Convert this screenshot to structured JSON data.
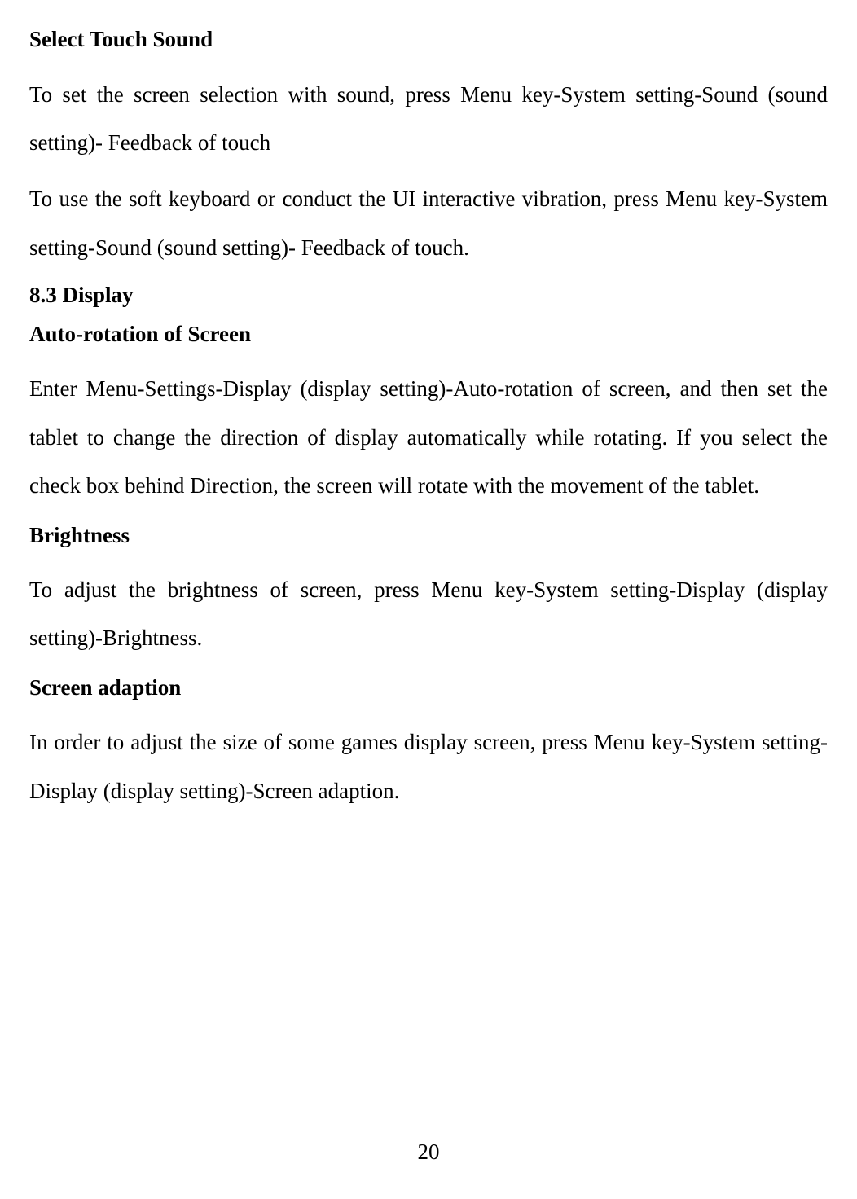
{
  "heading1": "Select Touch Sound",
  "para1": "To set the screen selection with sound, press Menu key-System setting-Sound (sound setting)- Feedback of touch",
  "para2": "To use the soft keyboard or conduct the UI interactive vibration, press Menu key-System setting-Sound (sound setting)- Feedback of touch.",
  "section": "8.3 Display",
  "heading2": "Auto-rotation of Screen",
  "para3": "Enter Menu-Settings-Display (display setting)-Auto-rotation of screen, and then set the tablet to change the direction of display automatically while rotating. If you select the check box behind Direction, the screen will rotate with the movement of the tablet.",
  "heading3": "Brightness",
  "para4": "To adjust the brightness of screen, press Menu key-System setting-Display (display setting)-Brightness.",
  "heading4": "Screen adaption",
  "para5": "In order to adjust the size of some games display screen, press Menu key-System setting-Display (display setting)-Screen adaption.",
  "pageNumber": "20"
}
